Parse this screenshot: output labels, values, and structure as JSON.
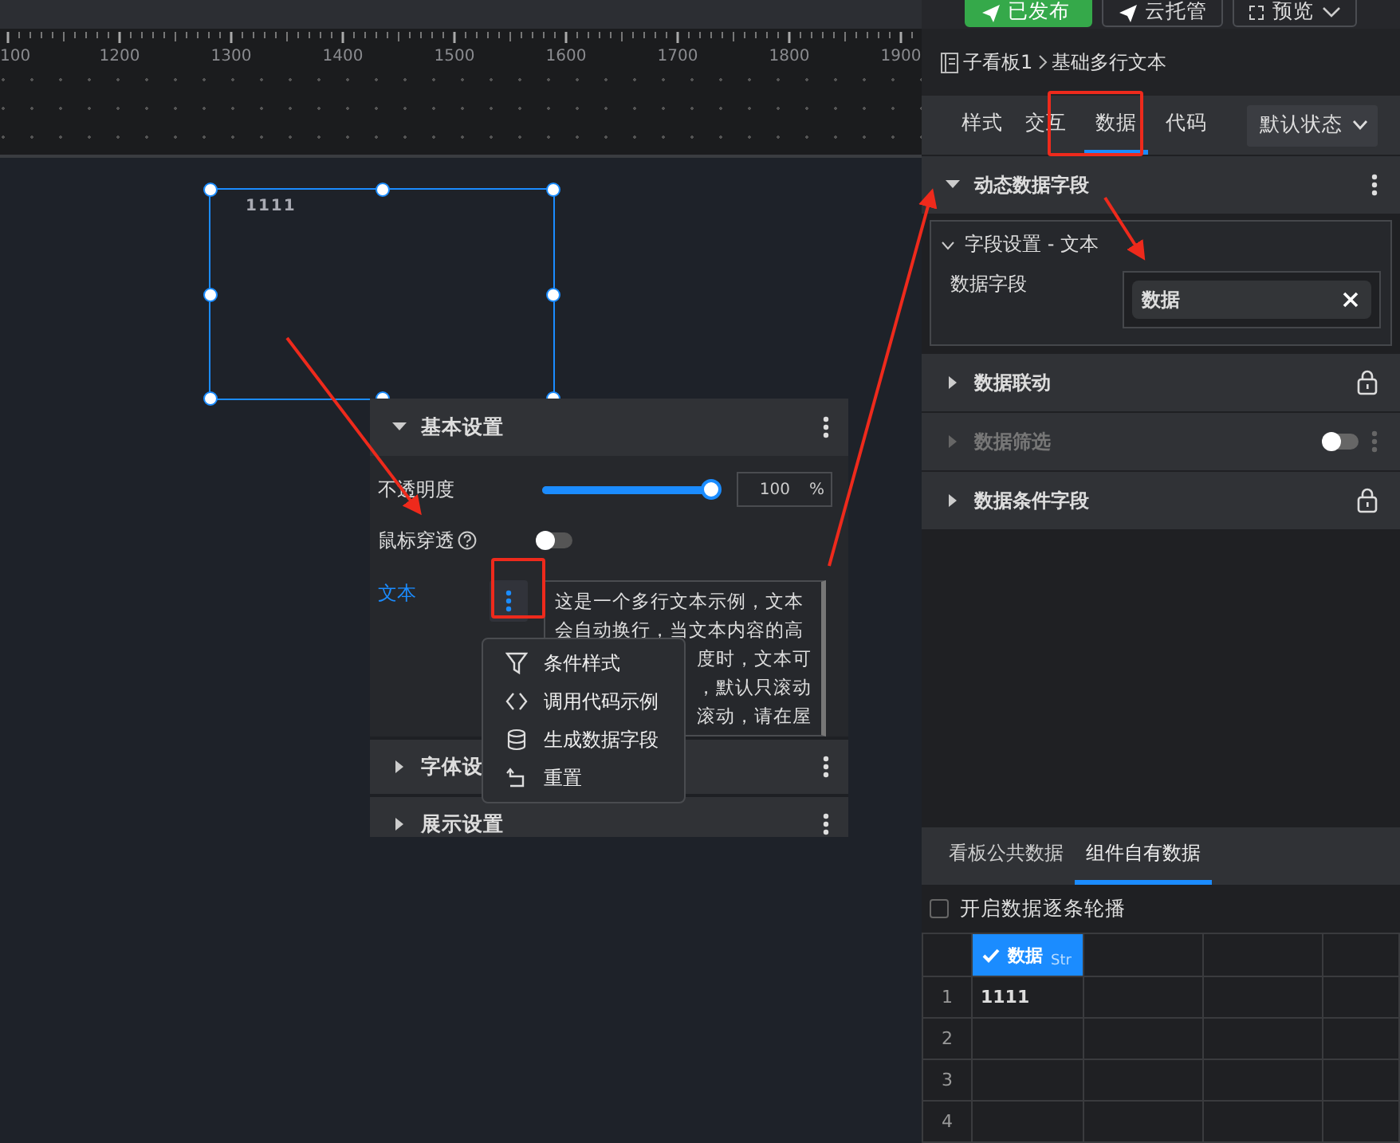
{
  "header_buttons": [
    {
      "label": "已发布",
      "kind": "primary"
    },
    {
      "label": "云托管",
      "kind": "plain"
    },
    {
      "label": "预览",
      "kind": "dropdown"
    }
  ],
  "ruler": {
    "labels": [
      "100",
      "1200",
      "1300",
      "1400",
      "1500",
      "1600",
      "1700",
      "1800",
      "1900"
    ]
  },
  "canvas": {
    "component_text": "1111"
  },
  "props": {
    "sections": [
      {
        "title": "基本设置",
        "expanded": true
      },
      {
        "title": "字体设",
        "expanded": false
      },
      {
        "title": "展示设置",
        "expanded": false
      }
    ],
    "opacity": {
      "label": "不透明度",
      "level": 1,
      "value": "100",
      "unit": "%"
    },
    "mouse_through": {
      "label": "鼠标穿透",
      "on": false
    },
    "text_field": {
      "label": "文本",
      "lines": [
        {
          "text": "这是一个多行文本示例，文本",
          "kind": "full"
        },
        {
          "text": "会自动换行，当文本内容的高",
          "kind": "full"
        },
        {
          "text": "度时，文本可",
          "kind": "tail"
        },
        {
          "text": "，默认只滚动",
          "kind": "tail"
        },
        {
          "text": "滚动，请在屋",
          "kind": "tail"
        }
      ]
    },
    "context_menu": [
      {
        "label": "条件样式",
        "kind": "filter"
      },
      {
        "label": "调用代码示例",
        "kind": "code"
      },
      {
        "label": "生成数据字段",
        "kind": "database"
      },
      {
        "label": "重置",
        "kind": "reset"
      }
    ]
  },
  "side": {
    "breadcrumb": [
      "子看板1",
      "基础多行文本"
    ],
    "tabs": [
      {
        "label": "样式",
        "selected": false
      },
      {
        "label": "交互",
        "selected": false
      },
      {
        "label": "数据",
        "selected": true
      },
      {
        "label": "代码",
        "selected": false
      }
    ],
    "state_dropdown": "默认状态",
    "sections": [
      {
        "title": "动态数据字段",
        "kind": "menu",
        "expanded": true,
        "disabled": false
      },
      {
        "title": "数据联动",
        "kind": "locked",
        "expanded": false,
        "disabled": false
      },
      {
        "title": "数据筛选",
        "kind": "toggle",
        "expanded": false,
        "disabled": true,
        "on": false
      },
      {
        "title": "数据条件字段",
        "kind": "locked",
        "expanded": false,
        "disabled": false
      }
    ],
    "field_group": {
      "title": "字段设置 - 文本",
      "field_label": "数据字段",
      "field_value": "数据"
    },
    "data_tabs": [
      {
        "label": "看板公共数据",
        "selected": false
      },
      {
        "label": "组件自有数据",
        "selected": true
      }
    ],
    "carousel": {
      "label": "开启数据逐条轮播",
      "checked": false
    },
    "table": {
      "columns": [
        {
          "name": "数据",
          "type": "Str",
          "checked": true
        }
      ],
      "rows": [
        {
          "number": "1",
          "cells": [
            "1111"
          ]
        },
        {
          "number": "2",
          "cells": []
        },
        {
          "number": "3",
          "cells": []
        },
        {
          "number": "4",
          "cells": []
        }
      ]
    }
  }
}
